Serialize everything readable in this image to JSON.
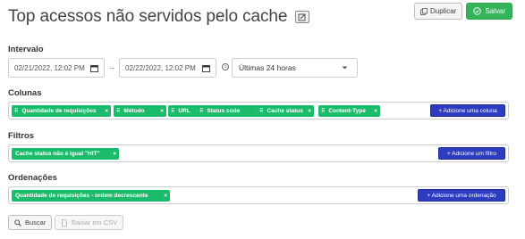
{
  "header": {
    "title": "Top acessos não servidos pelo cache",
    "duplicate_label": "Duplicar",
    "save_label": "Salvar"
  },
  "interval": {
    "label": "Intervalo",
    "start": "02/21/2022, 12:02 PM",
    "end": "02/22/2022, 12:02 PM",
    "separator": "→",
    "range_selected": "Últimas 24 horas"
  },
  "columns": {
    "label": "Colunas",
    "items": [
      "Quantidade de requisições",
      "Método",
      "URL",
      "Status code",
      "Cache status",
      "Content-Type"
    ],
    "add_label": "+ Adicione uma coluna"
  },
  "filters": {
    "label": "Filtros",
    "items": [
      "Cache status não é igual \"HIT\""
    ],
    "add_label": "+ Adicione um filtro"
  },
  "orderings": {
    "label": "Ordenações",
    "items": [
      "Quantidade de requisições - ordem decrescente"
    ],
    "add_label": "+ Adicione uma ordenação"
  },
  "actions": {
    "search_label": "Buscar",
    "download_label": "Baixar em CSV"
  },
  "colors": {
    "chip": "#1abc6c",
    "add_button": "#2e3cc0",
    "save": "#34b35a"
  }
}
